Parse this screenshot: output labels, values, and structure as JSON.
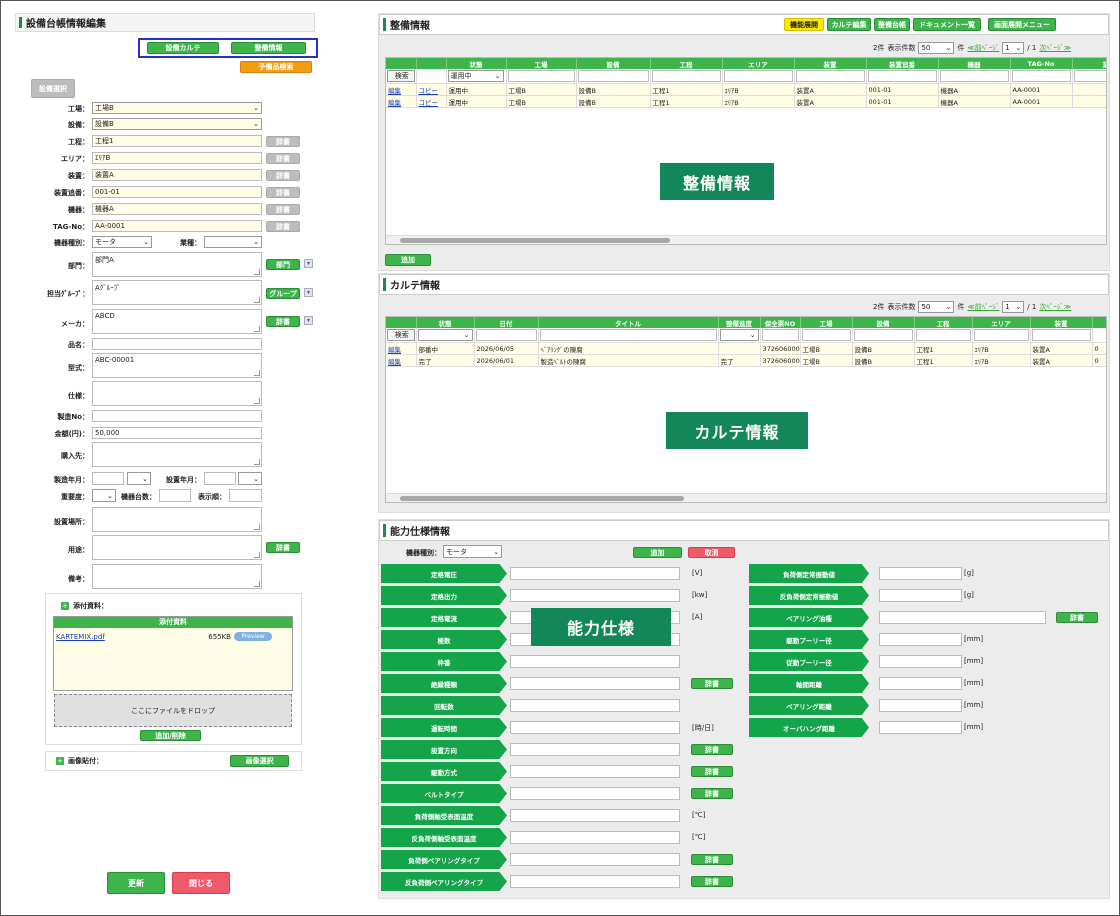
{
  "left": {
    "title": "設備台帳情報編集",
    "btn_karte": "設備カルテ",
    "btn_seibi": "整備情報",
    "btn_yobi": "予備品検索",
    "btn_setsubi_sentaku": "設備選択",
    "fields": {
      "kojo": {
        "label": "工場：",
        "value": "工場B"
      },
      "setsubi": {
        "label": "設備：",
        "value": "設備B"
      },
      "kotei": {
        "label": "工程：",
        "value": "工程1"
      },
      "area": {
        "label": "エリア：",
        "value": "ｴﾘｱB"
      },
      "sochi": {
        "label": "装置：",
        "value": "装置A"
      },
      "sochi_no": {
        "label": "装置追番：",
        "value": "001-01"
      },
      "kiki": {
        "label": "機器：",
        "value": "機器A"
      },
      "tag": {
        "label": "TAG-No：",
        "value": "AA-0001"
      },
      "kiki_shubetsu": {
        "label": "機器種別：",
        "value": "モータ"
      },
      "gyoshu": {
        "label": "業種：",
        "value": ""
      },
      "bumon": {
        "label": "部門：",
        "value": "部門A"
      },
      "tanto": {
        "label": "担当ｸﾞﾙｰﾌﾟ：",
        "value": "Aｸﾞﾙｰﾌﾟ"
      },
      "maker": {
        "label": "メーカ：",
        "value": "ABCD"
      },
      "hinmei": {
        "label": "品名：",
        "value": ""
      },
      "katashiki": {
        "label": "型式：",
        "value": "ABC-00001"
      },
      "shiyo": {
        "label": "仕様：",
        "value": ""
      },
      "seizo_no": {
        "label": "製造No：",
        "value": ""
      },
      "kingaku": {
        "label": "金額(円)：",
        "value": "50,000"
      },
      "konyu": {
        "label": "購入先：",
        "value": ""
      },
      "seizo_nengetsu": {
        "label": "製造年月：",
        "value": ""
      },
      "secchi_nengetsu": {
        "label": "設置年月：",
        "value": ""
      },
      "juyodo": {
        "label": "重要度：",
        "value": ""
      },
      "daisu": {
        "label": "機器台数：",
        "value": ""
      },
      "hyoji": {
        "label": "表示順：",
        "value": ""
      },
      "basho": {
        "label": "設置場所：",
        "value": ""
      },
      "yoto": {
        "label": "用途：",
        "value": ""
      },
      "biko": {
        "label": "備考：",
        "value": ""
      }
    },
    "jisho": "辞書",
    "bumon_btn": "部門",
    "group_btn": "グループ",
    "attach_title": "添付資料：",
    "attach_header": "添付資料",
    "attach_file": "KARTEMIX.pdf",
    "attach_size": "655KB",
    "preview": "Preview",
    "dropzone": "ここにファイルをドロップ",
    "add_delete": "追加/削除",
    "image_label": "画像貼付：",
    "image_select": "画像選択",
    "update": "更新",
    "close": "閉じる"
  },
  "seibi": {
    "title": "整備情報",
    "top_buttons": [
      "機能展開",
      "カルテ編集",
      "整備台帳",
      "ドキュメント一覧",
      "画面展開メニュー"
    ],
    "count": "2件",
    "per_page_label": "表示件数",
    "per_page": "50",
    "ken": "件",
    "prev": "≪前ﾍﾟｰｼﾞ",
    "page": "1",
    "total": "/ 1",
    "next": "次ﾍﾟｰｼﾞ≫",
    "columns": [
      "",
      "",
      "状態",
      "工場",
      "設備",
      "工程",
      "エリア",
      "装置",
      "装置追番",
      "機器",
      "TAG-No",
      "業務"
    ],
    "search": "検索",
    "filter_status": "運用中",
    "rows": [
      [
        "編集",
        "コピー",
        "運用中",
        "工場B",
        "設備B",
        "工程1",
        "ｴﾘｱB",
        "装置A",
        "001-01",
        "機器A",
        "AA-0001",
        ""
      ],
      [
        "編集",
        "コピー",
        "運用中",
        "工場B",
        "設備B",
        "工程1",
        "ｴﾘｱB",
        "装置A",
        "001-01",
        "機器A",
        "AA-0001",
        ""
      ]
    ],
    "overlay": "整備情報",
    "add": "追加"
  },
  "karte": {
    "title": "カルテ情報",
    "count": "2件",
    "per_page_label": "表示件数",
    "per_page": "50",
    "ken": "件",
    "prev": "≪前ﾍﾟｰｼﾞ",
    "page": "1",
    "total": "/ 1",
    "next": "次ﾍﾟｰｼﾞ≫",
    "columns": [
      "",
      "状態",
      "日付",
      "タイトル",
      "整備進度",
      "保全票NO",
      "工場",
      "設備",
      "工程",
      "エリア",
      "装置",
      ""
    ],
    "search": "検索",
    "rows": [
      [
        "編集",
        "部番中",
        "2026/06/05",
        "ﾍﾞｱﾘﾝｸﾞの陳腐",
        "",
        "372606000",
        "工場B",
        "設備B",
        "工程1",
        "ｴﾘｱB",
        "装置A",
        "0"
      ],
      [
        "編集",
        "完了",
        "2026/06/01",
        "製造ﾍﾞﾙﾄの陳腐",
        "完了",
        "372606000",
        "工場B",
        "設備B",
        "工程1",
        "ｴﾘｱB",
        "装置A",
        "0"
      ]
    ],
    "overlay": "カルテ情報"
  },
  "noryoku": {
    "title": "能力仕様情報",
    "kiki_label": "機器種別：",
    "kiki_value": "モータ",
    "add": "追加",
    "cancel": "取消",
    "overlay": "能力仕様",
    "left_items": [
      {
        "label": "定格電圧",
        "unit": "[V]",
        "dict": false
      },
      {
        "label": "定格出力",
        "unit": "[kw]",
        "dict": false
      },
      {
        "label": "定格電流",
        "unit": "[A]",
        "dict": false
      },
      {
        "label": "極数",
        "unit": "",
        "dict": false
      },
      {
        "label": "枠番",
        "unit": "",
        "dict": false
      },
      {
        "label": "絶縁種類",
        "unit": "",
        "dict": true
      },
      {
        "label": "回転数",
        "unit": "",
        "dict": false
      },
      {
        "label": "運転時間",
        "unit": "[時/日]",
        "dict": false
      },
      {
        "label": "設置方向",
        "unit": "",
        "dict": true
      },
      {
        "label": "駆動方式",
        "unit": "",
        "dict": true
      },
      {
        "label": "ベルトタイプ",
        "unit": "",
        "dict": true
      },
      {
        "label": "負荷側軸受表面温度",
        "unit": "[℃]",
        "dict": false
      },
      {
        "label": "反負荷側軸受表面温度",
        "unit": "[℃]",
        "dict": false
      },
      {
        "label": "負荷側ベアリングタイプ",
        "unit": "",
        "dict": true
      },
      {
        "label": "反負荷側ベアリングタイプ",
        "unit": "",
        "dict": true
      }
    ],
    "right_items": [
      {
        "label": "負荷側定常振動値",
        "unit": "[g]",
        "dict": false
      },
      {
        "label": "反負荷側定常振動値",
        "unit": "[g]",
        "dict": false
      },
      {
        "label": "ベアリング油種",
        "unit": "",
        "dict": true
      },
      {
        "label": "駆動プーリー径",
        "unit": "[mm]",
        "dict": false
      },
      {
        "label": "従動プーリー径",
        "unit": "[mm]",
        "dict": false
      },
      {
        "label": "軸間距離",
        "unit": "[mm]",
        "dict": false
      },
      {
        "label": "ベアリング距離",
        "unit": "[mm]",
        "dict": false
      },
      {
        "label": "オーバハング距離",
        "unit": "[mm]",
        "dict": false
      }
    ],
    "dict": "辞書"
  },
  "colors": {
    "green": "#3db54a",
    "dark_green": "#13875a",
    "red": "#ef5a6a",
    "orange": "#f39b13",
    "input_yellow": "#fffde6",
    "highlight_blue": "#2233cc"
  }
}
